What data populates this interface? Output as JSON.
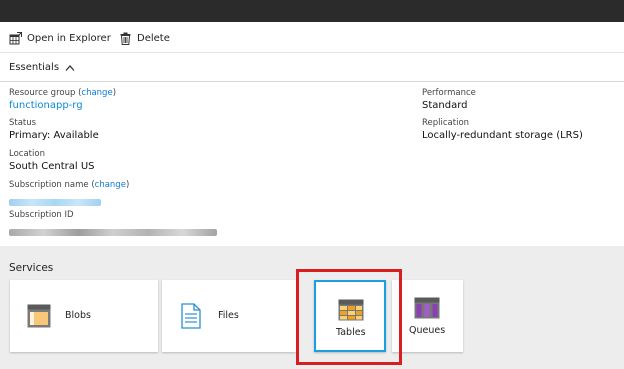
{
  "toolbar": {
    "open_in_explorer": "Open in Explorer",
    "delete": "Delete"
  },
  "essentials": {
    "title": "Essentials",
    "resource_group": {
      "label": "Resource group (",
      "change": "change",
      "close": ")",
      "value": "functionapp-rg"
    },
    "status": {
      "label": "Status",
      "value": "Primary: Available"
    },
    "location": {
      "label": "Location",
      "value": "South Central US"
    },
    "subscription_name": {
      "label": "Subscription name (",
      "change": "change",
      "close": ")"
    },
    "subscription_id": {
      "label": "Subscription ID"
    },
    "performance": {
      "label": "Performance",
      "value": "Standard"
    },
    "replication": {
      "label": "Replication",
      "value": "Locally-redundant storage (LRS)"
    }
  },
  "services": {
    "title": "Services",
    "tiles": [
      {
        "label": "Blobs",
        "icon": "blob-icon"
      },
      {
        "label": "Files",
        "icon": "file-icon"
      },
      {
        "label": "Tables",
        "icon": "table-icon",
        "selected": true
      },
      {
        "label": "Queues",
        "icon": "queue-icon"
      }
    ]
  },
  "colors": {
    "link": "#0a7bd8",
    "selected_border": "#1aa0e0",
    "highlight": "#d81e1e",
    "topbar": "#2b2b2b"
  }
}
